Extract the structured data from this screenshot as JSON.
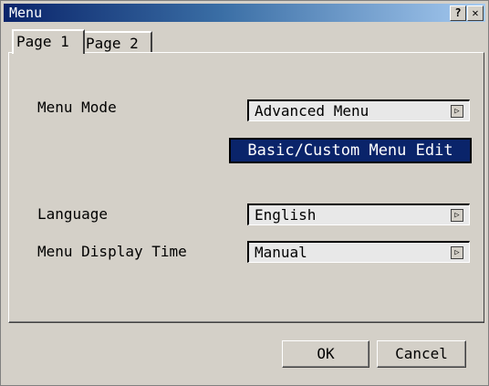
{
  "window": {
    "title": "Menu",
    "help_label": "?",
    "close_label": "✕"
  },
  "tabs": [
    {
      "label": "Page 1",
      "selected": true
    },
    {
      "label": "Page 2",
      "selected": false
    }
  ],
  "settings": {
    "menu_mode": {
      "label": "Menu Mode",
      "value": "Advanced Menu"
    },
    "custom_edit_label": "Basic/Custom Menu Edit",
    "language": {
      "label": "Language",
      "value": "English"
    },
    "display_time": {
      "label": "Menu Display Time",
      "value": "Manual"
    }
  },
  "dropdown_arrow": "▷",
  "footer": {
    "ok_label": "OK",
    "cancel_label": "Cancel"
  },
  "colors": {
    "title_gradient_start": "#0a246a",
    "title_gradient_end": "#a6caf0",
    "highlight_button": "#0a246a",
    "face": "#d4d0c8"
  }
}
